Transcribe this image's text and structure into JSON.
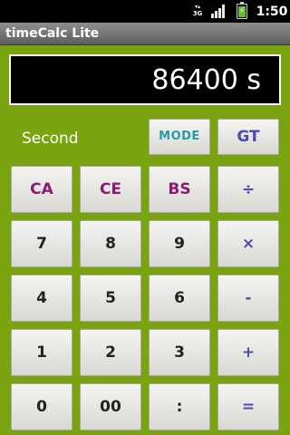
{
  "status_bar": {
    "network_label": "3G",
    "network_icon": "3g-network-icon",
    "signal_icon": "signal-bars-icon",
    "battery_icon": "battery-charging-icon",
    "battery_level": 0.8,
    "time": "1:50"
  },
  "app": {
    "title": "timeCalc Lite"
  },
  "display": {
    "value": "86400 s"
  },
  "mode_label": "Second",
  "buttons": {
    "mode": "MODE",
    "gt": "GT",
    "ca": "CA",
    "ce": "CE",
    "bs": "BS",
    "divide": "÷",
    "n7": "7",
    "n8": "8",
    "n9": "9",
    "multiply": "×",
    "n4": "4",
    "n5": "5",
    "n6": "6",
    "minus": "-",
    "n1": "1",
    "n2": "2",
    "n3": "3",
    "plus": "+",
    "n0": "0",
    "n00": "00",
    "colon": ":",
    "equals": "="
  },
  "colors": {
    "background": "#7aa40f",
    "key_function": "#8d1a74",
    "key_operator": "#4a4ab8",
    "key_mode": "#2a9aa6"
  }
}
